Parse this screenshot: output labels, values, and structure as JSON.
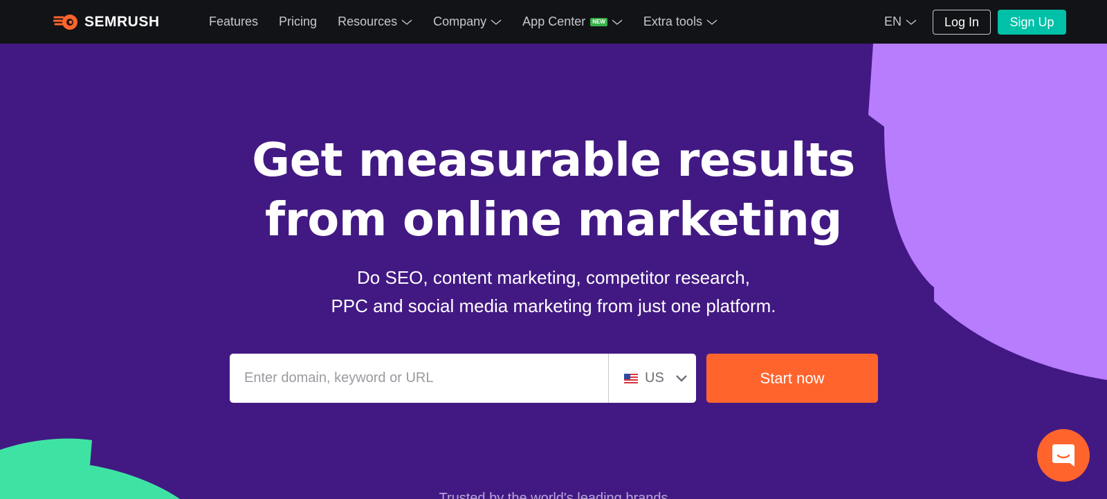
{
  "brand": {
    "name": "SEMRUSH",
    "logo_color": "#ff642d"
  },
  "nav": {
    "items": [
      {
        "label": "Features",
        "has_dropdown": false
      },
      {
        "label": "Pricing",
        "has_dropdown": false
      },
      {
        "label": "Resources",
        "has_dropdown": true
      },
      {
        "label": "Company",
        "has_dropdown": true
      },
      {
        "label": "App Center",
        "has_dropdown": true,
        "badge": "NEW"
      },
      {
        "label": "Extra tools",
        "has_dropdown": true
      }
    ],
    "language": "EN",
    "login_label": "Log In",
    "signup_label": "Sign Up"
  },
  "hero": {
    "title_line1": "Get measurable results",
    "title_line2": "from online marketing",
    "subtitle_line1": "Do SEO, content marketing, competitor research,",
    "subtitle_line2": "PPC and social media marketing from just one platform."
  },
  "search": {
    "placeholder": "Enter domain, keyword or URL",
    "value": "",
    "country": "US",
    "country_flag": "us-flag-icon",
    "submit_label": "Start now"
  },
  "trusted_text": "Trusted by the world's leading brands",
  "colors": {
    "background": "#421983",
    "nav_bg": "#121316",
    "accent_orange": "#ff642d",
    "accent_teal": "#00c1a7",
    "deco_purple": "#b77dfd",
    "deco_green": "#3ee3a4"
  },
  "chat": {
    "icon": "chat-icon"
  }
}
